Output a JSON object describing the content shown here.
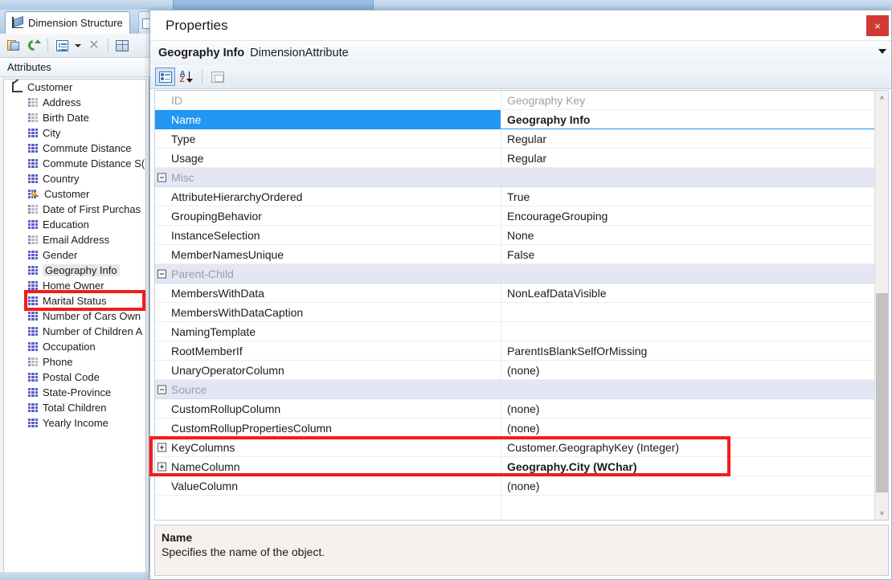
{
  "left_panel": {
    "tab_label": "Dimension Structure",
    "tab_icon": "dimension-structure-icon",
    "toolbar": {
      "new_attribute_label": "New Attribute",
      "refresh_label": "Refresh",
      "view_list_label": "Show Attributes In",
      "dropdown_label": "More",
      "delete_label": "Delete",
      "grid_label": "Show Data Source View"
    },
    "section_header": "Attributes",
    "tree": {
      "root": "Customer",
      "items": [
        {
          "label": "Address",
          "icon": "attribute-icon",
          "dim": true
        },
        {
          "label": "Birth Date",
          "icon": "attribute-icon",
          "dim": true
        },
        {
          "label": "City",
          "icon": "attribute-icon",
          "dim": false
        },
        {
          "label": "Commute Distance",
          "icon": "attribute-icon",
          "dim": false
        },
        {
          "label": "Commute Distance S(",
          "icon": "attribute-icon",
          "dim": false
        },
        {
          "label": "Country",
          "icon": "attribute-icon",
          "dim": false
        },
        {
          "label": "Customer",
          "icon": "key-attribute-icon",
          "dim": false
        },
        {
          "label": "Date of First Purchas",
          "icon": "attribute-icon",
          "dim": true
        },
        {
          "label": "Education",
          "icon": "attribute-icon",
          "dim": false
        },
        {
          "label": "Email Address",
          "icon": "attribute-icon",
          "dim": true
        },
        {
          "label": "Gender",
          "icon": "attribute-icon",
          "dim": false
        },
        {
          "label": "Geography Info",
          "icon": "attribute-icon",
          "dim": false,
          "highlighted": true
        },
        {
          "label": "Home Owner",
          "icon": "attribute-icon",
          "dim": false
        },
        {
          "label": "Marital Status",
          "icon": "attribute-icon",
          "dim": false
        },
        {
          "label": "Number of Cars Own",
          "icon": "attribute-icon",
          "dim": false
        },
        {
          "label": "Number of Children A",
          "icon": "attribute-icon",
          "dim": false
        },
        {
          "label": "Occupation",
          "icon": "attribute-icon",
          "dim": false
        },
        {
          "label": "Phone",
          "icon": "attribute-icon",
          "dim": true
        },
        {
          "label": "Postal Code",
          "icon": "attribute-icon",
          "dim": false
        },
        {
          "label": "State-Province",
          "icon": "attribute-icon",
          "dim": false
        },
        {
          "label": "Total Children",
          "icon": "attribute-icon",
          "dim": false
        },
        {
          "label": "Yearly Income",
          "icon": "attribute-icon",
          "dim": false
        }
      ]
    }
  },
  "properties": {
    "window_title": "Properties",
    "close_label": "×",
    "object_name": "Geography Info",
    "object_type": "DimensionAttribute",
    "toolbar": {
      "categorized_label": "Categorized",
      "alphabetical_label": "Alphabetical",
      "property_pages_label": "Property Pages"
    },
    "rows": [
      {
        "name": "ID",
        "value": "Geography Key",
        "style": "dimmed"
      },
      {
        "name": "Name",
        "value": "Geography Info",
        "style": "selected"
      },
      {
        "name": "Type",
        "value": "Regular",
        "style": "normal"
      },
      {
        "name": "Usage",
        "value": "Regular",
        "style": "normal"
      },
      {
        "name": "Misc",
        "value": "",
        "style": "group"
      },
      {
        "name": "AttributeHierarchyOrdered",
        "value": "True",
        "style": "normal"
      },
      {
        "name": "GroupingBehavior",
        "value": "EncourageGrouping",
        "style": "normal"
      },
      {
        "name": "InstanceSelection",
        "value": "None",
        "style": "normal"
      },
      {
        "name": "MemberNamesUnique",
        "value": "False",
        "style": "normal"
      },
      {
        "name": "Parent-Child",
        "value": "",
        "style": "group"
      },
      {
        "name": "MembersWithData",
        "value": "NonLeafDataVisible",
        "style": "normal"
      },
      {
        "name": "MembersWithDataCaption",
        "value": "",
        "style": "normal"
      },
      {
        "name": "NamingTemplate",
        "value": "",
        "style": "normal"
      },
      {
        "name": "RootMemberIf",
        "value": "ParentIsBlankSelfOrMissing",
        "style": "normal"
      },
      {
        "name": "UnaryOperatorColumn",
        "value": "(none)",
        "style": "normal"
      },
      {
        "name": "Source",
        "value": "",
        "style": "group"
      },
      {
        "name": "CustomRollupColumn",
        "value": "(none)",
        "style": "normal"
      },
      {
        "name": "CustomRollupPropertiesColumn",
        "value": "(none)",
        "style": "normal"
      },
      {
        "name": "KeyColumns",
        "value": "Customer.GeographyKey (Integer)",
        "style": "expandable"
      },
      {
        "name": "NameColumn",
        "value": "Geography.City (WChar)",
        "style": "expandable-bold"
      },
      {
        "name": "ValueColumn",
        "value": "(none)",
        "style": "normal"
      }
    ],
    "scrollbar": {
      "up_arrow": "˄",
      "down_arrow": "˅"
    },
    "description": {
      "title": "Name",
      "text": "Specifies the name of the object."
    }
  },
  "annotations": {
    "highlight_color": "#f41c1c",
    "tree_highlight_target": "Geography Info",
    "grid_highlight_targets": [
      "KeyColumns",
      "NameColumn"
    ]
  }
}
